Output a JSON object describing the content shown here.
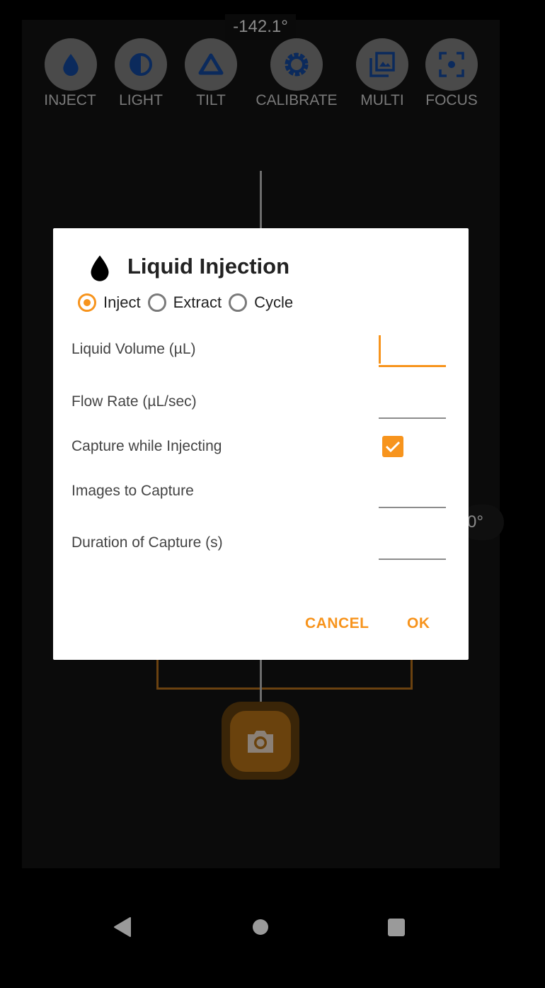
{
  "camera": {
    "rotation_readout": "-142.1°",
    "side_readout": "0°",
    "toolbar": [
      {
        "label": "INJECT",
        "icon": "water-drop-icon"
      },
      {
        "label": "LIGHT",
        "icon": "contrast-icon"
      },
      {
        "label": "TILT",
        "icon": "triangle-icon"
      },
      {
        "label": "CALIBRATE",
        "icon": "gear-icon"
      },
      {
        "label": "MULTI",
        "icon": "photo-library-icon"
      },
      {
        "label": "FOCUS",
        "icon": "center-focus-icon"
      }
    ],
    "shutter_icon": "camera-icon"
  },
  "dialog": {
    "title": "Liquid Injection",
    "title_icon": "water-drop-icon",
    "modes": [
      {
        "label": "Inject",
        "selected": true
      },
      {
        "label": "Extract",
        "selected": false
      },
      {
        "label": "Cycle",
        "selected": false
      }
    ],
    "fields": [
      {
        "label": "Liquid Volume (µL)",
        "value": "",
        "focused": true
      },
      {
        "label": "Flow Rate (µL/sec)",
        "value": ""
      },
      {
        "label": "Capture while Injecting",
        "type": "checkbox",
        "checked": true
      },
      {
        "label": "Images to Capture",
        "value": ""
      },
      {
        "label": "Duration of Capture (s)",
        "value": ""
      }
    ],
    "cancel_label": "CANCEL",
    "ok_label": "OK",
    "accent_color": "#f7941d"
  },
  "nav_bar": {
    "back": "back-icon",
    "home": "home-icon",
    "recents": "recents-icon"
  }
}
